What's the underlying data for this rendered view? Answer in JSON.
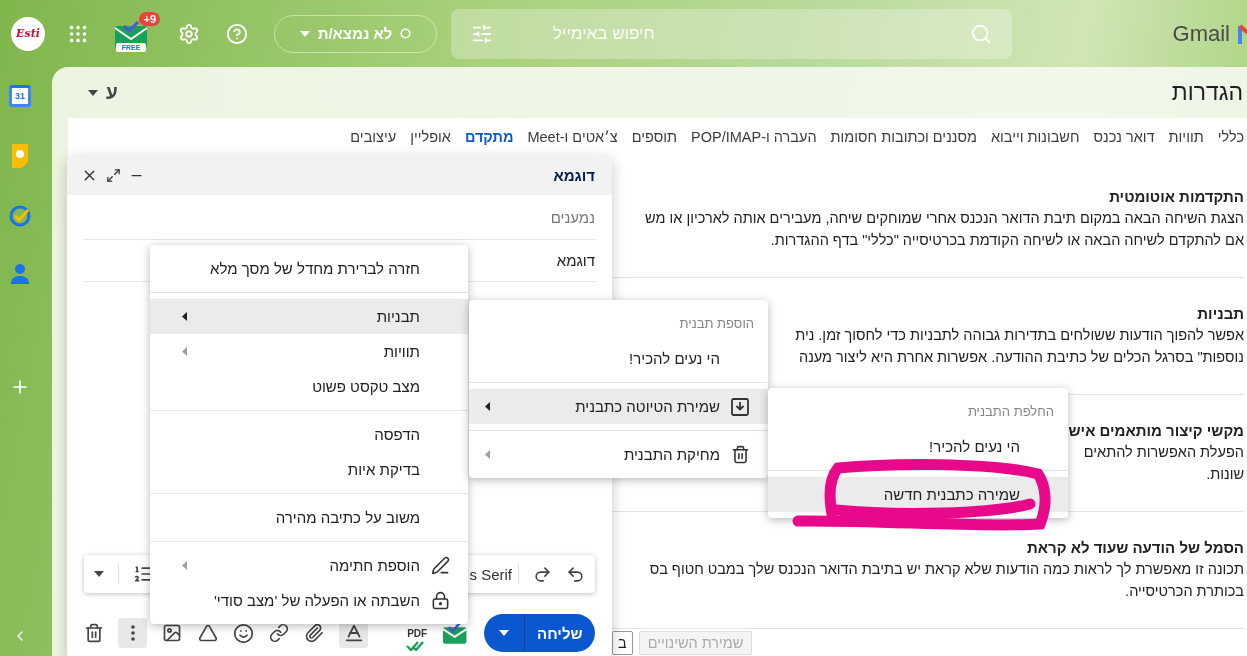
{
  "account": {
    "avatar_text": "Esti"
  },
  "extension": {
    "badge": "+9",
    "label": "FREE"
  },
  "status": {
    "label": "לא נמצא/ת"
  },
  "search": {
    "placeholder": "חיפוש באימייל"
  },
  "logo": {
    "text": "Gmail"
  },
  "rail": [
    {
      "kind": "calendar",
      "label": "31"
    },
    {
      "kind": "keep"
    },
    {
      "kind": "tasks"
    },
    {
      "kind": "contacts"
    },
    {
      "kind": "add"
    }
  ],
  "settings": {
    "title": "הגדרות",
    "input_tool": "ע",
    "tabs": [
      {
        "label": "כללי",
        "selected": false
      },
      {
        "label": "תוויות",
        "selected": false
      },
      {
        "label": "דואר נכנס",
        "selected": false
      },
      {
        "label": "חשבונות וייבוא",
        "selected": false
      },
      {
        "label": "מסננים וכתובות חסומות",
        "selected": false
      },
      {
        "label": "העברה ו-POP/IMAP",
        "selected": false
      },
      {
        "label": "תוספים",
        "selected": false
      },
      {
        "label": "צ׳אטים ו-Meet",
        "selected": false
      },
      {
        "label": "מתקדם",
        "selected": true
      },
      {
        "label": "אופליין",
        "selected": false
      },
      {
        "label": "עיצובים",
        "selected": false
      }
    ],
    "sections": [
      {
        "title": "התקדמות אוטומטית",
        "lines": [
          "הצגת השיחה הבאה במקום תיבת הדואר הנכנס אחרי שמוחקים שיחה, מעבירים אותה לארכיון או מש",
          "אם להתקדם לשיחה הבאה או לשיחה הקודמת בכרטיסייה \"כללי\" בדף ההגדרות."
        ]
      },
      {
        "title": "תבניות",
        "lines": [
          "אפשר להפוך הודעות ששולחים בתדירות גבוהה לתבניות כדי לחסוך זמן. נית",
          "נוספות\" בסרגל הכלים של כתיבת ההודעה. אפשרות אחרת היא ליצור מענה"
        ]
      },
      {
        "title": "מקשי קיצור מותאמים איש",
        "lines": [
          "הפעלת האפשרות להתאים",
          "שונות."
        ]
      },
      {
        "title": "הסמל של הודעה שעוד לא קראת",
        "lines": [
          "תכונה זו מאפשרת לך לראות כמה הודעות שלא קראת יש בתיבת הדואר הנכנס שלך במבט חטוף בס",
          "בכותרת הכרטיסייה."
        ]
      }
    ],
    "buttons": [
      {
        "label": "שמירת השינויים",
        "disabled": true
      },
      {
        "label": "ב",
        "disabled": false
      }
    ]
  },
  "compose": {
    "title": "דוגמא",
    "recipients": {
      "placeholder": "נמענים"
    },
    "subject": {
      "value": "דוגמא"
    },
    "format_toolbar": {
      "font": "s Serif"
    },
    "send": {
      "label": "שליחה"
    },
    "pdf_label": "PDF",
    "tools": [
      {
        "kind": "format",
        "active": true
      },
      {
        "kind": "attach",
        "active": false
      },
      {
        "kind": "link",
        "active": false
      },
      {
        "kind": "emoji",
        "active": false
      },
      {
        "kind": "drive",
        "active": false
      },
      {
        "kind": "photo",
        "active": false
      },
      {
        "kind": "more",
        "active": true
      }
    ]
  },
  "menus": [
    {
      "items": [
        {
          "kind": "item",
          "label": "חזרה לברירת מחדל של מסך מלא",
          "submenu": false,
          "highlighted": false
        },
        {
          "kind": "divider"
        },
        {
          "kind": "item",
          "label": "תבניות",
          "submenu": true,
          "highlighted": true
        },
        {
          "kind": "item",
          "label": "תוויות",
          "submenu": true,
          "highlighted": false
        },
        {
          "kind": "item",
          "label": "מצב טקסט פשוט",
          "submenu": false,
          "highlighted": false
        },
        {
          "kind": "divider"
        },
        {
          "kind": "item",
          "label": "הדפסה",
          "submenu": false,
          "highlighted": false
        },
        {
          "kind": "item",
          "label": "בדיקת איות",
          "submenu": false,
          "highlighted": false
        },
        {
          "kind": "divider"
        },
        {
          "kind": "item",
          "label": "משוב על כתיבה מהירה",
          "submenu": false,
          "highlighted": false
        },
        {
          "kind": "divider"
        },
        {
          "kind": "signature",
          "label": "הוספת חתימה",
          "submenu": true,
          "highlighted": false
        },
        {
          "kind": "confidential",
          "label": "השבתה או הפעלה של 'מצב סודי'",
          "submenu": false,
          "highlighted": false
        }
      ]
    },
    {
      "items": [
        {
          "kind": "header",
          "label": "הוספת תבנית"
        },
        {
          "kind": "item",
          "label": "הי נעים להכיר!",
          "submenu": false,
          "highlighted": false
        },
        {
          "kind": "divider"
        },
        {
          "kind": "save",
          "label": "שמירת הטיוטה כתבנית",
          "submenu": true,
          "highlighted": true
        },
        {
          "kind": "divider"
        },
        {
          "kind": "delete",
          "label": "מחיקת התבנית",
          "submenu": true,
          "highlighted": false
        }
      ]
    },
    {
      "items": [
        {
          "kind": "header",
          "label": "החלפת התבנית"
        },
        {
          "kind": "item",
          "label": "הי נעים להכיר!",
          "submenu": false,
          "highlighted": false
        },
        {
          "kind": "divider"
        },
        {
          "kind": "item",
          "label": "שמירה כתבנית חדשה",
          "submenu": false,
          "highlighted": true
        }
      ]
    }
  ]
}
